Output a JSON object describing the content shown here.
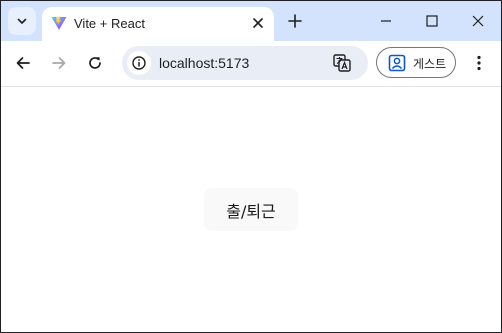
{
  "browser": {
    "tab": {
      "title": "Vite + React",
      "favicon": "vite-logo-icon"
    },
    "address_bar": {
      "url": "localhost:5173"
    },
    "profile": {
      "label": "게스트"
    }
  },
  "page": {
    "clock_button_label": "출/퇴근"
  },
  "colors": {
    "tabstrip": "#d3e3fd",
    "omnibox": "#e9eef6",
    "button_bg": "#f9f9f9"
  }
}
